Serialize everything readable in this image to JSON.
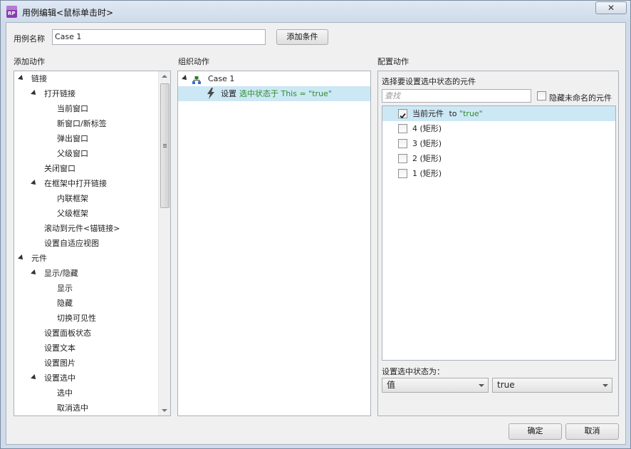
{
  "window": {
    "title": "用例编辑<鼠标单击时>",
    "close_label": "✕"
  },
  "case_name": {
    "label": "用例名称",
    "value": "Case 1",
    "add_condition": "添加条件"
  },
  "sections": {
    "add_action": "添加动作",
    "organize_action": "组织动作",
    "configure_action": "配置动作"
  },
  "add_action_tree": [
    {
      "label": "链接"
    },
    {
      "label": "打开链接"
    },
    {
      "label": "当前窗口"
    },
    {
      "label": "新窗口/新标签"
    },
    {
      "label": "弹出窗口"
    },
    {
      "label": "父级窗口"
    },
    {
      "label": "关闭窗口"
    },
    {
      "label": "在框架中打开链接"
    },
    {
      "label": "内联框架"
    },
    {
      "label": "父级框架"
    },
    {
      "label": "滚动到元件<锚链接>"
    },
    {
      "label": "设置自适应视图"
    },
    {
      "label": "元件"
    },
    {
      "label": "显示/隐藏"
    },
    {
      "label": "显示"
    },
    {
      "label": "隐藏"
    },
    {
      "label": "切换可见性"
    },
    {
      "label": "设置面板状态"
    },
    {
      "label": "设置文本"
    },
    {
      "label": "设置图片"
    },
    {
      "label": "设置选中"
    },
    {
      "label": "选中"
    },
    {
      "label": "取消选中"
    }
  ],
  "organize": {
    "case_label": "Case 1",
    "action_prefix": "设置",
    "action_detail": "选中状态于 This = \"true\""
  },
  "configure": {
    "heading": "选择要设置选中状态的元件",
    "search_placeholder": "查找",
    "hide_unnamed_label": "隐藏未命名的元件",
    "widgets": [
      {
        "name": "当前元件",
        "suffix": " to ",
        "value": "\"true\"",
        "checked": true
      },
      {
        "name": "4 (矩形)",
        "suffix": "",
        "value": "",
        "checked": false
      },
      {
        "name": "3 (矩形)",
        "suffix": "",
        "value": "",
        "checked": false
      },
      {
        "name": "2 (矩形)",
        "suffix": "",
        "value": "",
        "checked": false
      },
      {
        "name": "1 (矩形)",
        "suffix": "",
        "value": "",
        "checked": false
      }
    ],
    "set_state_label": "设置选中状态为：",
    "mode_value": "值",
    "state_value": "true"
  },
  "footer": {
    "ok": "确定",
    "cancel": "取消"
  }
}
